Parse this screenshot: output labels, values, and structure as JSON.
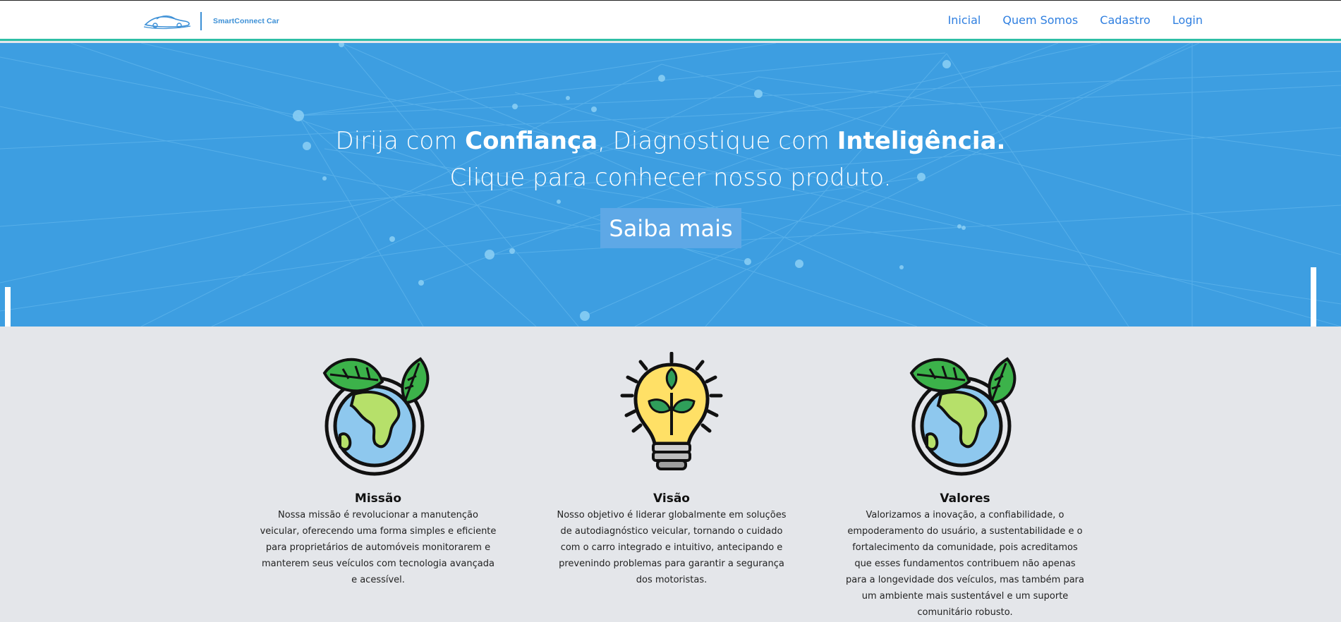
{
  "brand": {
    "name": "SmartConnect Car",
    "color": "#3b8fd6"
  },
  "nav": {
    "items": [
      {
        "label": "Inicial"
      },
      {
        "label": "Quem Somos"
      },
      {
        "label": "Cadastro"
      },
      {
        "label": "Login"
      }
    ],
    "link_color": "#2f7fe0"
  },
  "hero": {
    "line1_part1": "Dirija com ",
    "line1_bold1": "Confiança",
    "line1_part2": ", Diagnostique com ",
    "line1_bold2": "Inteligência.",
    "line2": "Clique para conhecer nosso produto.",
    "cta_label": "Saiba mais",
    "background": "#3d9ee1"
  },
  "features": [
    {
      "icon": "globe-leaf-icon",
      "title": "Missão",
      "text": "Nossa missão é revolucionar a manutenção veicular, oferecendo uma forma simples e eficiente para proprietários de automóveis monitorarem e manterem seus veículos com tecnologia avançada e acessível."
    },
    {
      "icon": "lightbulb-plant-icon",
      "title": "Visão",
      "text": "Nosso objetivo é liderar globalmente em soluções de autodiagnóstico veicular, tornando o cuidado com o carro integrado e intuitivo, antecipando e prevenindo problemas para garantir a segurança dos motoristas."
    },
    {
      "icon": "globe-leaf-icon",
      "title": "Valores",
      "text": "Valorizamos a inovação, a confiabilidade, o empoderamento do usuário, a sustentabilidade e o fortalecimento da comunidade, pois acreditamos que esses fundamentos contribuem não apenas para a longevidade dos veículos, mas também para um ambiente mais sustentável e um suporte comunitário robusto."
    }
  ]
}
